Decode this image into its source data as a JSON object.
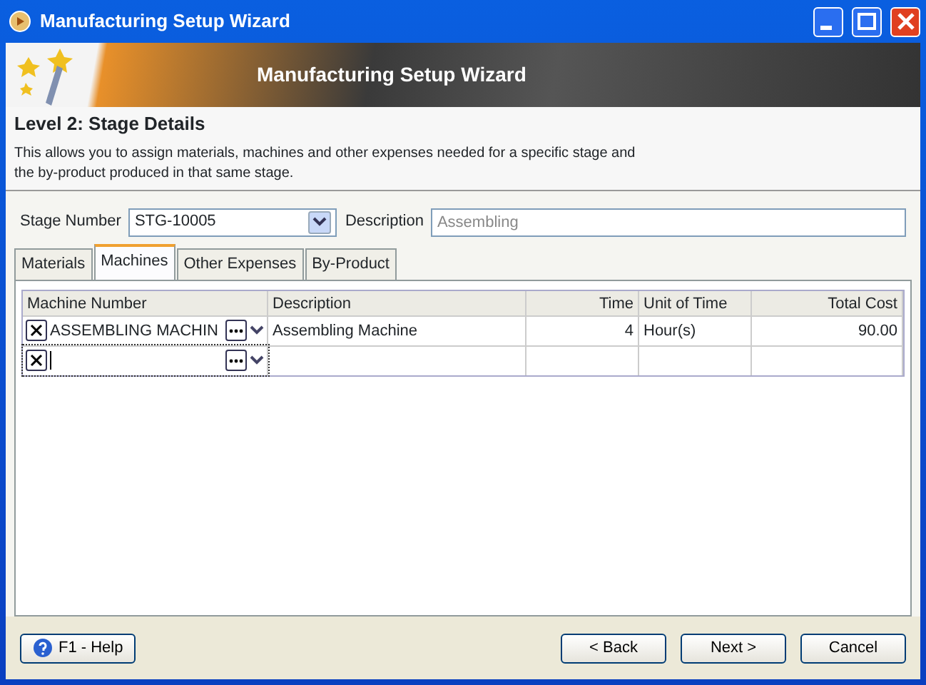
{
  "window": {
    "title": "Manufacturing Setup Wizard"
  },
  "banner": {
    "title": "Manufacturing Setup Wizard"
  },
  "header": {
    "title": "Level 2: Stage Details",
    "description": "This allows you to assign materials, machines and other expenses needed for a specific stage and the by-product produced in that same stage."
  },
  "stage_number": {
    "label": "Stage Number",
    "value": "STG-10005"
  },
  "stage_description": {
    "label": "Description",
    "value": "Assembling",
    "disabled": true
  },
  "tabs": [
    {
      "label": "Materials",
      "selected": false
    },
    {
      "label": "Machines",
      "selected": true
    },
    {
      "label": "Other Expenses",
      "selected": false
    },
    {
      "label": "By-Product",
      "selected": false
    }
  ],
  "table": {
    "columns": [
      {
        "label": "Machine Number"
      },
      {
        "label": "Description"
      },
      {
        "label": "Time"
      },
      {
        "label": "Unit of Time"
      },
      {
        "label": "Total Cost"
      }
    ],
    "rows": [
      {
        "machine_number": "ASSEMBLING MACHIN",
        "description": "Assembling Machine",
        "time": "4",
        "unit": "Hour(s)",
        "total_cost": "90.00",
        "editing": false
      },
      {
        "editing": true
      }
    ]
  },
  "buttons": [
    {
      "label": "F1 - Help",
      "kind": "help"
    },
    {
      "label": "< Back",
      "kind": "nav"
    },
    {
      "label": "Next >",
      "kind": "nav"
    },
    {
      "label": "Cancel",
      "kind": "nav"
    }
  ]
}
